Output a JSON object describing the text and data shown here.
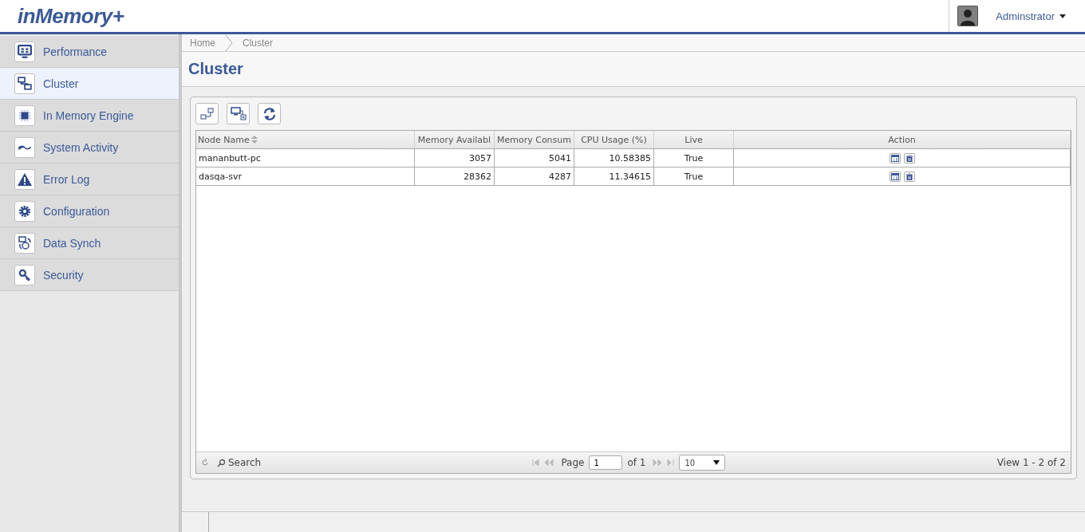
{
  "app": {
    "logo": "inMemory+",
    "user": "Adminstrator"
  },
  "sidebar": {
    "items": [
      {
        "label": "Performance",
        "selected": false
      },
      {
        "label": "Cluster",
        "selected": true
      },
      {
        "label": "In Memory Engine",
        "selected": false
      },
      {
        "label": "System Activity",
        "selected": false
      },
      {
        "label": "Error Log",
        "selected": false
      },
      {
        "label": "Configuration",
        "selected": false
      },
      {
        "label": "Data Synch",
        "selected": false
      },
      {
        "label": "Security",
        "selected": false
      }
    ]
  },
  "breadcrumb": [
    "Home",
    "Cluster"
  ],
  "page_title": "Cluster",
  "table": {
    "columns": [
      {
        "label": "Node Name",
        "kind": "text",
        "sorted": true
      },
      {
        "label": "Memory Availabl",
        "kind": "number",
        "sorted": false
      },
      {
        "label": "Memory Consum",
        "kind": "number",
        "sorted": false
      },
      {
        "label": "CPU Usage (%)",
        "kind": "number",
        "sorted": false
      },
      {
        "label": "Live",
        "kind": "center",
        "sorted": false
      },
      {
        "label": "Action",
        "kind": "actions",
        "sorted": false
      }
    ],
    "rows": [
      [
        "mananbutt-pc",
        "3057",
        "5041",
        "10.58385",
        "True"
      ],
      [
        "dasqa-svr",
        "28362",
        "4287",
        "11.34615",
        "True"
      ]
    ]
  },
  "pager": {
    "search": "Search",
    "page_label": "Page",
    "page": "1",
    "of": "of 1",
    "page_size": "10",
    "view": "View 1 - 2 of 2"
  }
}
